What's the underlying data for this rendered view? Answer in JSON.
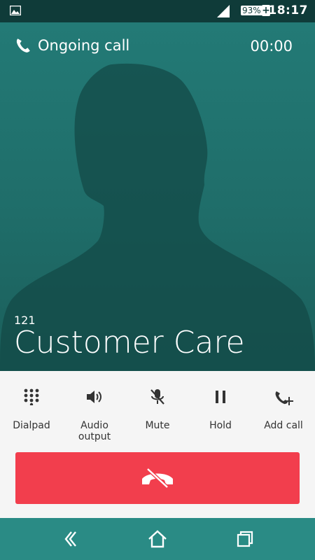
{
  "status_bar": {
    "time": "18:17",
    "battery_percent": "93%",
    "battery_charging_symbol": "+",
    "left_icon": "image-icon",
    "signal_icon": "signal-icon"
  },
  "call": {
    "status_label": "Ongoing call",
    "timer": "00:00",
    "number": "121",
    "name": "Customer Care",
    "background_color": "#1f6b68"
  },
  "actions": [
    {
      "label": "Dialpad",
      "icon": "dialpad-icon"
    },
    {
      "label": "Audio output",
      "icon": "speaker-icon"
    },
    {
      "label": "Mute",
      "icon": "mute-microphone-icon"
    },
    {
      "label": "Hold",
      "icon": "pause-icon"
    },
    {
      "label": "Add call",
      "icon": "add-call-icon"
    }
  ],
  "end_call": {
    "icon": "end-call-icon",
    "color": "#f23e4d"
  },
  "navigation": {
    "back": "back-icon",
    "home": "home-icon",
    "recents": "recents-icon"
  }
}
